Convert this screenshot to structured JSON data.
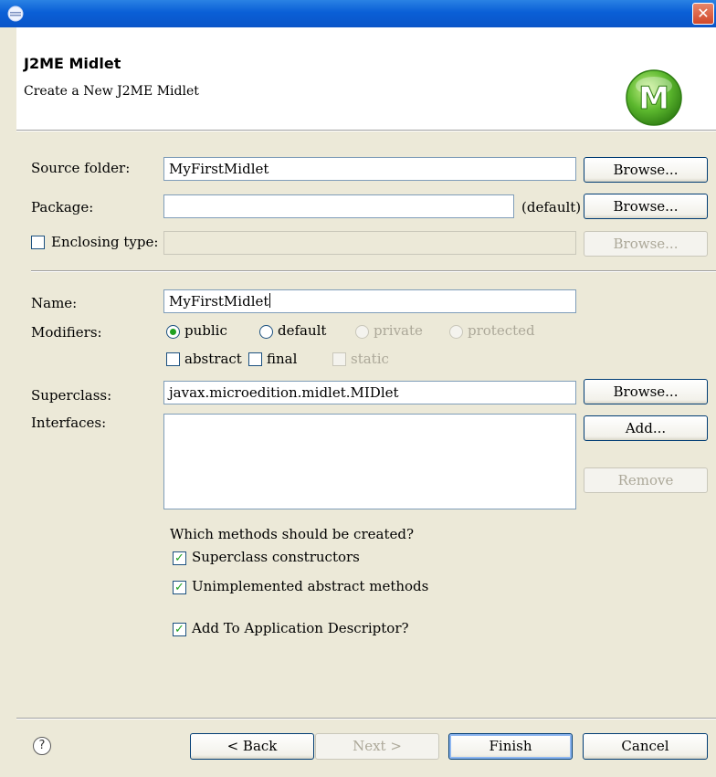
{
  "window": {
    "title": "",
    "icon": "eclipse-icon",
    "close_glyph": "✕"
  },
  "header": {
    "title": "J2ME Midlet",
    "subtitle": "Create a New J2ME Midlet",
    "logo_letter": "M",
    "logo_color": "#5cb82e"
  },
  "form": {
    "source_folder": {
      "label": "Source folder:",
      "value": "MyFirstMidlet",
      "browse": "Browse..."
    },
    "package": {
      "label": "Package:",
      "value": "",
      "hint": "(default)",
      "browse": "Browse..."
    },
    "enclosing_type": {
      "label": "Enclosing type:",
      "checked": false,
      "value": "",
      "browse": "Browse..."
    },
    "name": {
      "label": "Name:",
      "value": "MyFirstMidlet"
    },
    "modifiers": {
      "label": "Modifiers:",
      "radios": [
        {
          "label": "public",
          "selected": true,
          "enabled": true
        },
        {
          "label": "default",
          "selected": false,
          "enabled": true
        },
        {
          "label": "private",
          "selected": false,
          "enabled": false
        },
        {
          "label": "protected",
          "selected": false,
          "enabled": false
        }
      ],
      "checkboxes": [
        {
          "label": "abstract",
          "checked": false,
          "enabled": true
        },
        {
          "label": "final",
          "checked": false,
          "enabled": true
        },
        {
          "label": "static",
          "checked": false,
          "enabled": false
        }
      ]
    },
    "superclass": {
      "label": "Superclass:",
      "value": "javax.microedition.midlet.MIDlet",
      "browse": "Browse..."
    },
    "interfaces": {
      "label": "Interfaces:",
      "add": "Add...",
      "remove": "Remove"
    },
    "methods": {
      "question": "Which methods should be created?",
      "options": [
        {
          "label": "Superclass constructors",
          "checked": true
        },
        {
          "label": "Unimplemented abstract methods",
          "checked": true
        }
      ]
    },
    "descriptor": {
      "label": "Add To Application Descriptor?",
      "checked": true
    }
  },
  "footer": {
    "help_glyph": "?",
    "back": "< Back",
    "next": "Next >",
    "finish": "Finish",
    "cancel": "Cancel"
  },
  "colors": {
    "accent": "#0a5fd6",
    "check": "#21a121",
    "dialog_bg": "#ece9d8"
  }
}
